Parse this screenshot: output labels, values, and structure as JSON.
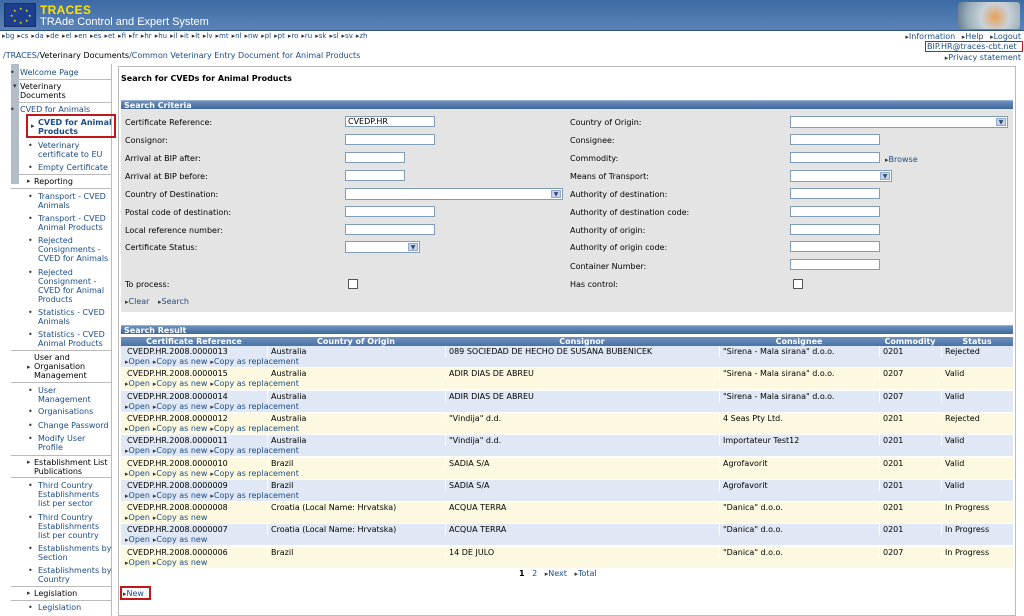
{
  "banner": {
    "title": "TRACES",
    "subtitle": "TRAde Control and Expert System"
  },
  "languages": [
    "bg",
    "cs",
    "da",
    "de",
    "el",
    "en",
    "es",
    "et",
    "fi",
    "fr",
    "hr",
    "hu",
    "il",
    "it",
    "lt",
    "lv",
    "mt",
    "nl",
    "nw",
    "pl",
    "pt",
    "ro",
    "ru",
    "sk",
    "sl",
    "sv",
    "zh"
  ],
  "top_links": {
    "information": "Information",
    "help": "Help",
    "logout": "Logout"
  },
  "breadcrumb": {
    "part1": "/TRACES/",
    "part2": "Veterinary Documents",
    "part3": "/Common Veterinary Entry Document for Animal Products"
  },
  "user_email": "BIP.HR@traces-cbt.net",
  "privacy": "Privacy statement",
  "sidebar": {
    "welcome": "Welcome Page",
    "vet_docs": "Veterinary Documents",
    "cved_animals": "CVED for Animals",
    "cved_products": "CVED for Animal Products",
    "vet_cert": "Veterinary certificate to EU",
    "empty_cert": "Empty Certificate",
    "reporting": "Reporting",
    "transport_animals": "Transport - CVED Animals",
    "transport_products": "Transport - CVED Animal Products",
    "rejected_animals": "Rejected Consignments - CVED for Animals",
    "rejected_products": "Rejected Consignment - CVED for Animal Products",
    "stats_animals": "Statistics - CVED Animals",
    "stats_products": "Statistics - CVED Animal Products",
    "user_org": "User and Organisation Management",
    "user_mgmt": "User Management",
    "organisations": "Organisations",
    "change_password": "Change Password",
    "modify_profile": "Modify User Profile",
    "estab_pub": "Establishment List Publications",
    "third_sector": "Third Country Establishments list per sector",
    "third_country": "Third Country Establishments list per country",
    "estab_section": "Establishments by Section",
    "estab_country": "Establishments by Country",
    "legislation_group": "Legislation",
    "legislation": "Legislation"
  },
  "page_title": "Search for CVEDs for Animal Products",
  "search_criteria": {
    "title": "Search Criteria",
    "cert_ref_label": "Certificate Reference:",
    "cert_ref_value": "CVEDP.HR",
    "consignor_label": "Consignor:",
    "arrival_after_label": "Arrival at BIP after:",
    "arrival_before_label": "Arrival at BIP before:",
    "country_dest_label": "Country of Destination:",
    "postal_label": "Postal code of destination:",
    "local_ref_label": "Local reference number:",
    "cert_status_label": "Certificate Status:",
    "to_process_label": "To process:",
    "country_origin_label": "Country of Origin:",
    "consignee_label": "Consignee:",
    "commodity_label": "Commodity:",
    "browse": "Browse",
    "transport_label": "Means of Transport:",
    "auth_dest_label": "Authority of destination:",
    "auth_dest_code_label": "Authority of destination code:",
    "auth_origin_label": "Authority of origin:",
    "auth_origin_code_label": "Authority of origin code:",
    "container_label": "Container Number:",
    "has_control_label": "Has control:",
    "clear": "Clear",
    "search": "Search"
  },
  "results": {
    "title": "Search Result",
    "columns": [
      "Certificate Reference",
      "Country of Origin",
      "Consignor",
      "Consignee",
      "Commodity",
      "Status"
    ],
    "open": "Open",
    "copy_new": "Copy as new",
    "copy_replacement": "Copy as replacement",
    "rows": [
      {
        "ref": "CVEDP.HR.2008.0000013",
        "country": "Australia",
        "consignor": "089 SOCIEDAD DE HECHO DE SUSANA BUBENICEK",
        "consignee": "\"Sirena - Mala sirana\" d.o.o.",
        "commodity": "0201",
        "status": "Rejected",
        "repl": true
      },
      {
        "ref": "CVEDP.HR.2008.0000015",
        "country": "Australia",
        "consignor": "ADIR DIAS DE ABREU",
        "consignee": "\"Sirena - Mala sirana\" d.o.o.",
        "commodity": "0207",
        "status": "Valid",
        "repl": true
      },
      {
        "ref": "CVEDP.HR.2008.0000014",
        "country": "Australia",
        "consignor": "ADIR DIAS DE ABREU",
        "consignee": "\"Sirena - Mala sirana\" d.o.o.",
        "commodity": "0207",
        "status": "Valid",
        "repl": true
      },
      {
        "ref": "CVEDP.HR.2008.0000012",
        "country": "Australia",
        "consignor": "\"Vindija\" d.d.",
        "consignee": "4 Seas Pty Ltd.",
        "commodity": "0201",
        "status": "Rejected",
        "repl": true
      },
      {
        "ref": "CVEDP.HR.2008.0000011",
        "country": "Australia",
        "consignor": "\"Vindija\" d.d.",
        "consignee": "Importateur Test12",
        "commodity": "0201",
        "status": "Valid",
        "repl": true
      },
      {
        "ref": "CVEDP.HR.2008.0000010",
        "country": "Brazil",
        "consignor": "SADIA S/A",
        "consignee": "Agrofavorit",
        "commodity": "0201",
        "status": "Valid",
        "repl": true
      },
      {
        "ref": "CVEDP.HR.2008.0000009",
        "country": "Brazil",
        "consignor": "SADIA S/A",
        "consignee": "Agrofavorit",
        "commodity": "0201",
        "status": "Valid",
        "repl": true
      },
      {
        "ref": "CVEDP.HR.2008.0000008",
        "country": "Croatia (Local Name: Hrvatska)",
        "consignor": "ACQUA TERRA",
        "consignee": "\"Danica\" d.o.o.",
        "commodity": "0201",
        "status": "In Progress",
        "repl": false
      },
      {
        "ref": "CVEDP.HR.2008.0000007",
        "country": "Croatia (Local Name: Hrvatska)",
        "consignor": "ACQUA TERRA",
        "consignee": "\"Danica\" d.o.o.",
        "commodity": "0201",
        "status": "In Progress",
        "repl": false
      },
      {
        "ref": "CVEDP.HR.2008.0000006",
        "country": "Brazil",
        "consignor": "14 DE JULO",
        "consignee": "\"Danica\" d.o.o.",
        "commodity": "0207",
        "status": "In Progress",
        "repl": false
      }
    ]
  },
  "pager": {
    "page1": "1",
    "page2": "2",
    "next": "Next",
    "total": "Total"
  },
  "new_link": "New",
  "colors": {
    "banner": "#3c6aa4",
    "header": "#4a72a6",
    "row_blue": "#dfe8f4",
    "row_yellow": "#fcf9e0",
    "highlight": "#c01818"
  }
}
